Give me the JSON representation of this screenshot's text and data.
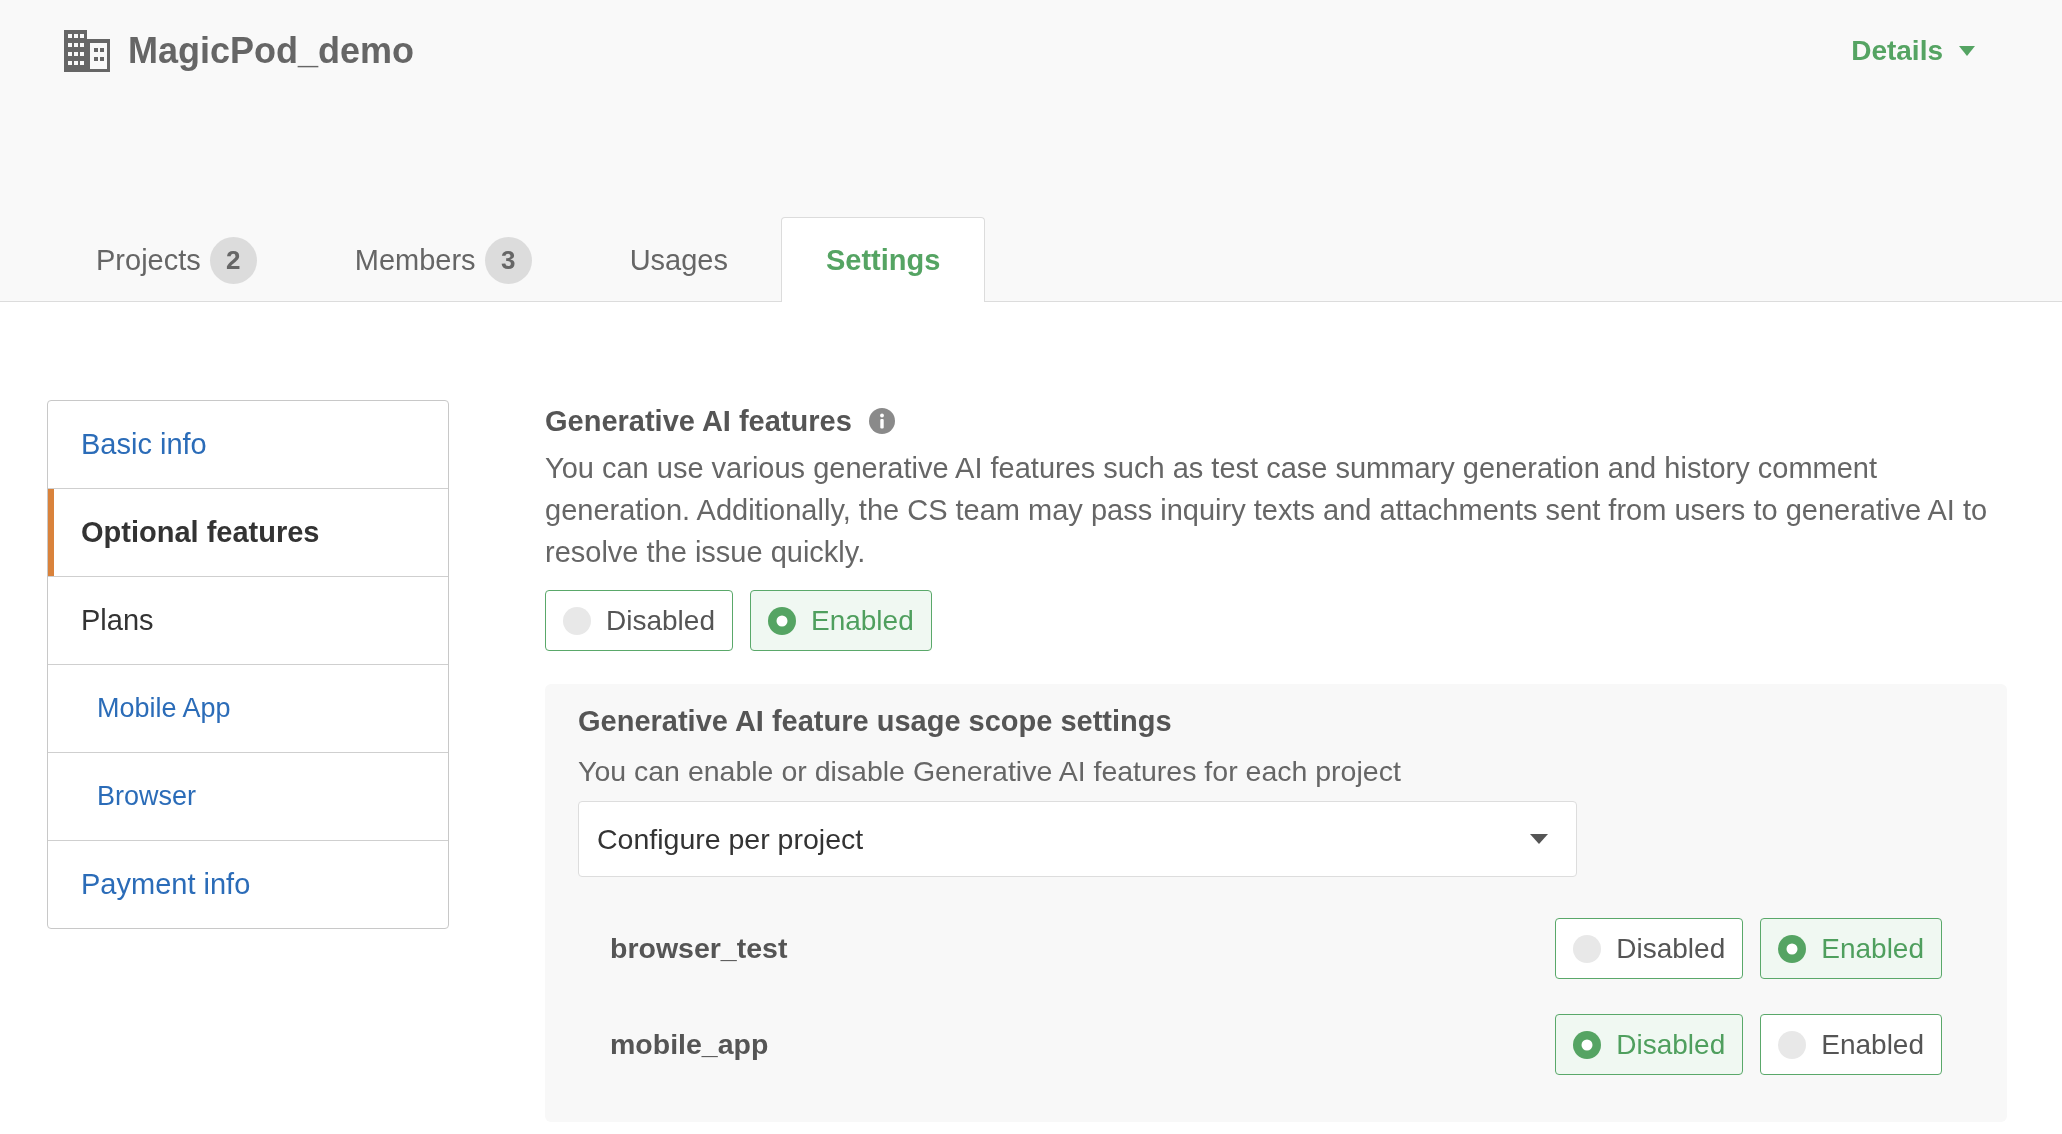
{
  "header": {
    "organization": "MagicPod_demo",
    "menu": {
      "label": "Details"
    }
  },
  "tabs": [
    {
      "label": "Projects",
      "count": "2",
      "selected": false
    },
    {
      "label": "Members",
      "count": "3",
      "selected": false
    },
    {
      "label": "Usages",
      "selected": false
    },
    {
      "label": "Settings",
      "selected": true
    }
  ],
  "sidebar": {
    "items": [
      {
        "label": "Basic info",
        "kind": "link",
        "selected": false
      },
      {
        "label": "Optional features",
        "kind": "link",
        "selected": true
      },
      {
        "label": "Plans",
        "kind": "group",
        "selected": false,
        "children": [
          {
            "label": "Mobile App",
            "kind": "link",
            "selected": false
          },
          {
            "label": "Browser",
            "kind": "link",
            "selected": false
          }
        ]
      },
      {
        "label": "Payment info",
        "kind": "link",
        "selected": false
      }
    ]
  },
  "generative_ai": {
    "title": "Generative AI features",
    "description": "You can use various generative AI features such as test case summary generation and history comment generation. Additionally, the CS team may pass inquiry texts and attachments sent from users to generative AI to resolve the issue quickly.",
    "options": [
      {
        "label": "Disabled",
        "selected": false
      },
      {
        "label": "Enabled",
        "selected": true
      }
    ],
    "scope": {
      "title": "Generative AI feature usage scope settings",
      "description": "You can enable or disable Generative AI features for each project",
      "select": {
        "value": "Configure per project"
      },
      "projects": [
        {
          "name": "browser_test",
          "options": [
            {
              "label": "Disabled",
              "selected": false
            },
            {
              "label": "Enabled",
              "selected": true
            }
          ]
        },
        {
          "name": "mobile_app",
          "options": [
            {
              "label": "Disabled",
              "selected": true
            },
            {
              "label": "Enabled",
              "selected": false
            }
          ]
        }
      ]
    }
  }
}
